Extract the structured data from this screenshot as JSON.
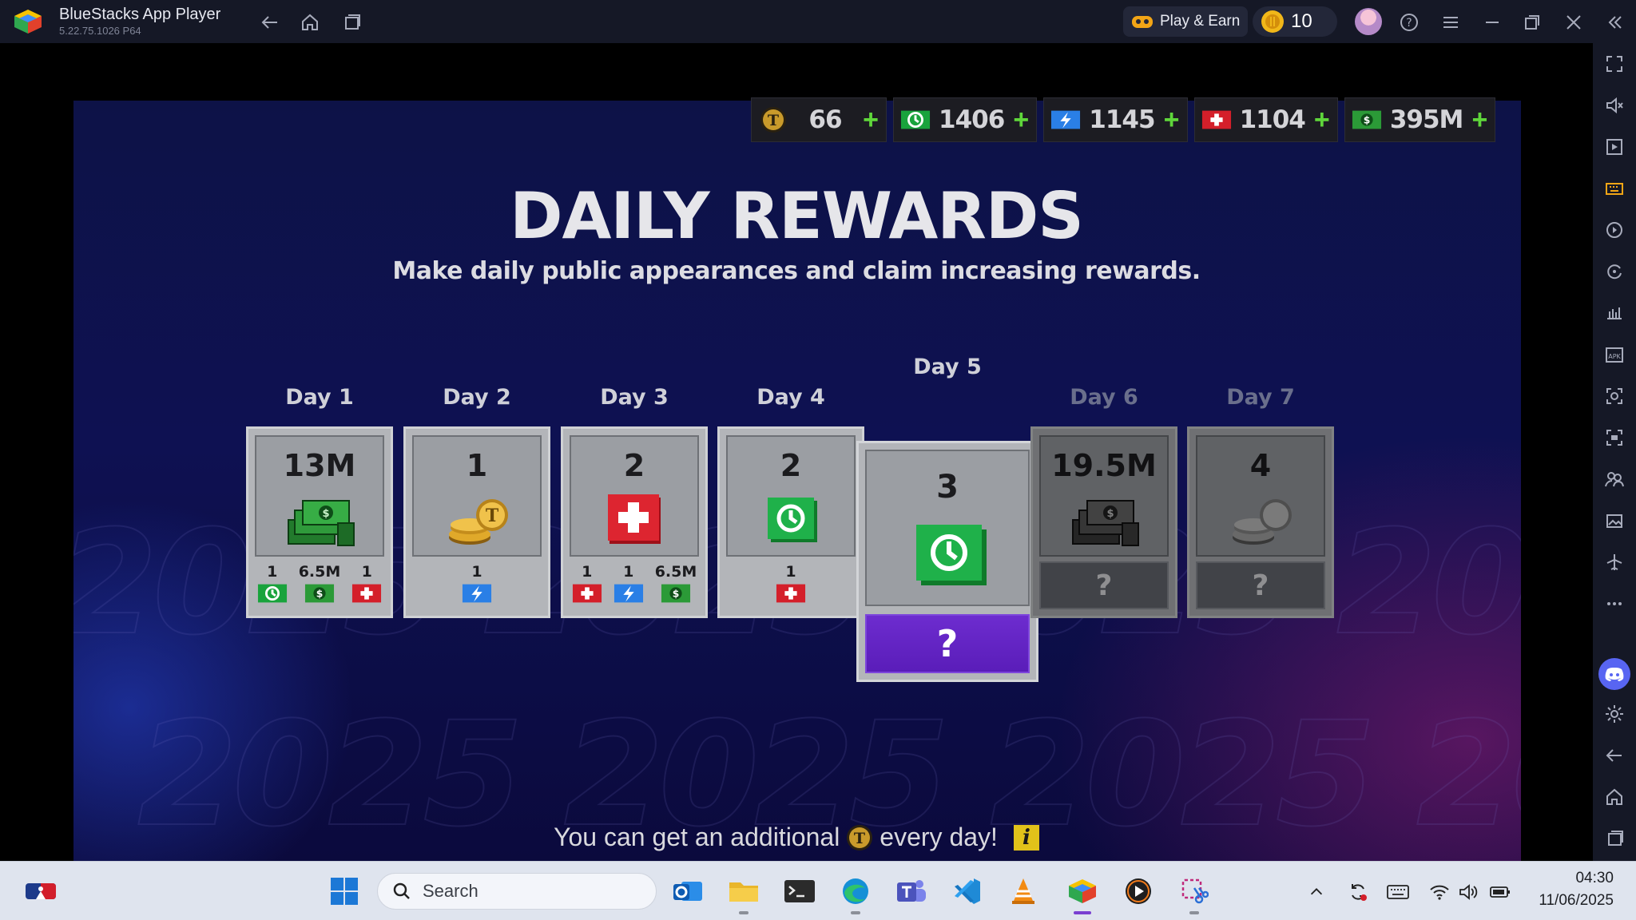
{
  "window": {
    "app_name": "BlueStacks App Player",
    "version": "5.22.75.1026  P64",
    "play_earn_label": "Play & Earn",
    "coin_count": "10"
  },
  "resources": [
    {
      "name": "t-token",
      "value": "66"
    },
    {
      "name": "timewarp",
      "value": "1406"
    },
    {
      "name": "energy",
      "value": "1145"
    },
    {
      "name": "medkit",
      "value": "1104"
    },
    {
      "name": "cash",
      "value": "395M"
    }
  ],
  "game": {
    "title": "DAILY REWARDS",
    "subtitle": "Make daily public appearances and claim increasing rewards.",
    "days": [
      {
        "label": "Day 1",
        "amount": "13M",
        "art": "cash-stack",
        "bonuses": [
          {
            "count": "1",
            "icon": "timewarp-icon"
          },
          {
            "count": "6.5M",
            "icon": "cash-icon"
          },
          {
            "count": "1",
            "icon": "medkit-icon"
          }
        ]
      },
      {
        "label": "Day 2",
        "amount": "1",
        "art": "t-coins",
        "bonuses": [
          {
            "count": "1",
            "icon": "energy-icon"
          }
        ]
      },
      {
        "label": "Day 3",
        "amount": "2",
        "art": "medkit",
        "bonuses": [
          {
            "count": "1",
            "icon": "medkit-icon"
          },
          {
            "count": "1",
            "icon": "energy-icon"
          },
          {
            "count": "6.5M",
            "icon": "cash-icon"
          }
        ]
      },
      {
        "label": "Day 4",
        "amount": "2",
        "art": "timewarp",
        "bonuses": [
          {
            "count": "1",
            "icon": "medkit-icon"
          }
        ]
      },
      {
        "label": "Day 5",
        "amount": "3",
        "art": "timewarp",
        "mystery": "?"
      },
      {
        "label": "Day 6",
        "amount": "19.5M",
        "art": "cash-stack",
        "mystery": "?"
      },
      {
        "label": "Day 7",
        "amount": "4",
        "art": "t-coins",
        "mystery": "?"
      }
    ],
    "bottom_note_before": "You can get an additional",
    "bottom_note_after": "every day!",
    "info_label": "i"
  },
  "taskbar": {
    "search_placeholder": "Search",
    "time": "04:30",
    "date": "11/06/2025"
  },
  "colors": {
    "accent_green": "#5fd63b",
    "mystery_purple": "#6d2ccf",
    "game_bg": "#0d1247"
  }
}
